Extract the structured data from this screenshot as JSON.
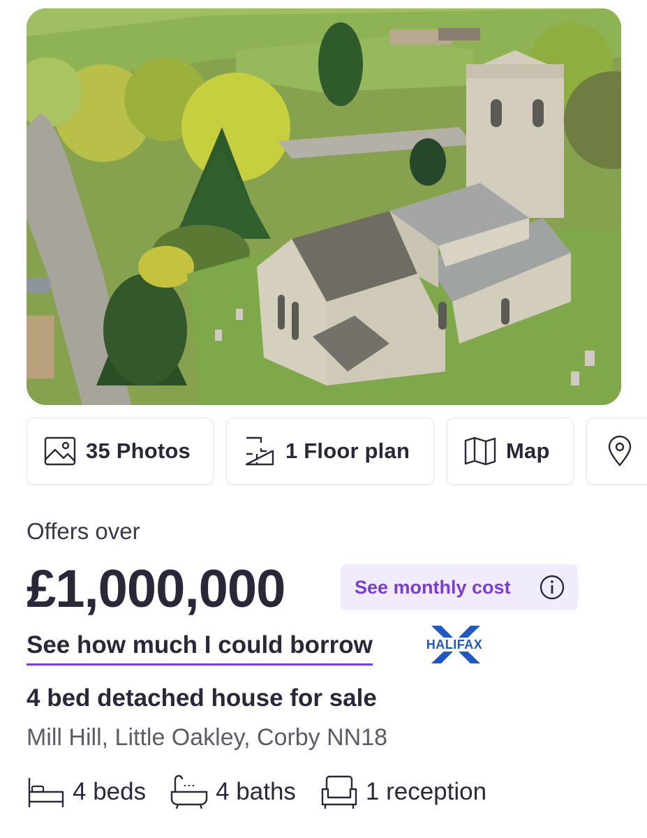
{
  "media_buttons": [
    {
      "label": "35 Photos",
      "icon": "photo-icon"
    },
    {
      "label": "1 Floor plan",
      "icon": "floor-plan-icon"
    },
    {
      "label": "Map",
      "icon": "map-icon"
    },
    {
      "label": "",
      "icon": "location-pin-icon"
    }
  ],
  "price": {
    "qualifier": "Offers over",
    "amount": "£1,000,000",
    "monthly_cost_label": "See monthly cost"
  },
  "mortgage": {
    "borrow_link": "See how much I could borrow",
    "partner_logo_text": "HALIFAX"
  },
  "listing": {
    "title": "4 bed detached house for sale",
    "address": "Mill Hill, Little Oakley, Corby NN18"
  },
  "features": [
    {
      "label": "4 beds",
      "icon": "bed-icon"
    },
    {
      "label": "4 baths",
      "icon": "bath-icon"
    },
    {
      "label": "1 reception",
      "icon": "armchair-icon"
    }
  ],
  "colors": {
    "accent": "#7a3ed8",
    "accent_bg": "#f0ecfb",
    "text": "#2a2838",
    "muted": "#5d5b6a",
    "halifax_blue": "#1f58c4"
  }
}
